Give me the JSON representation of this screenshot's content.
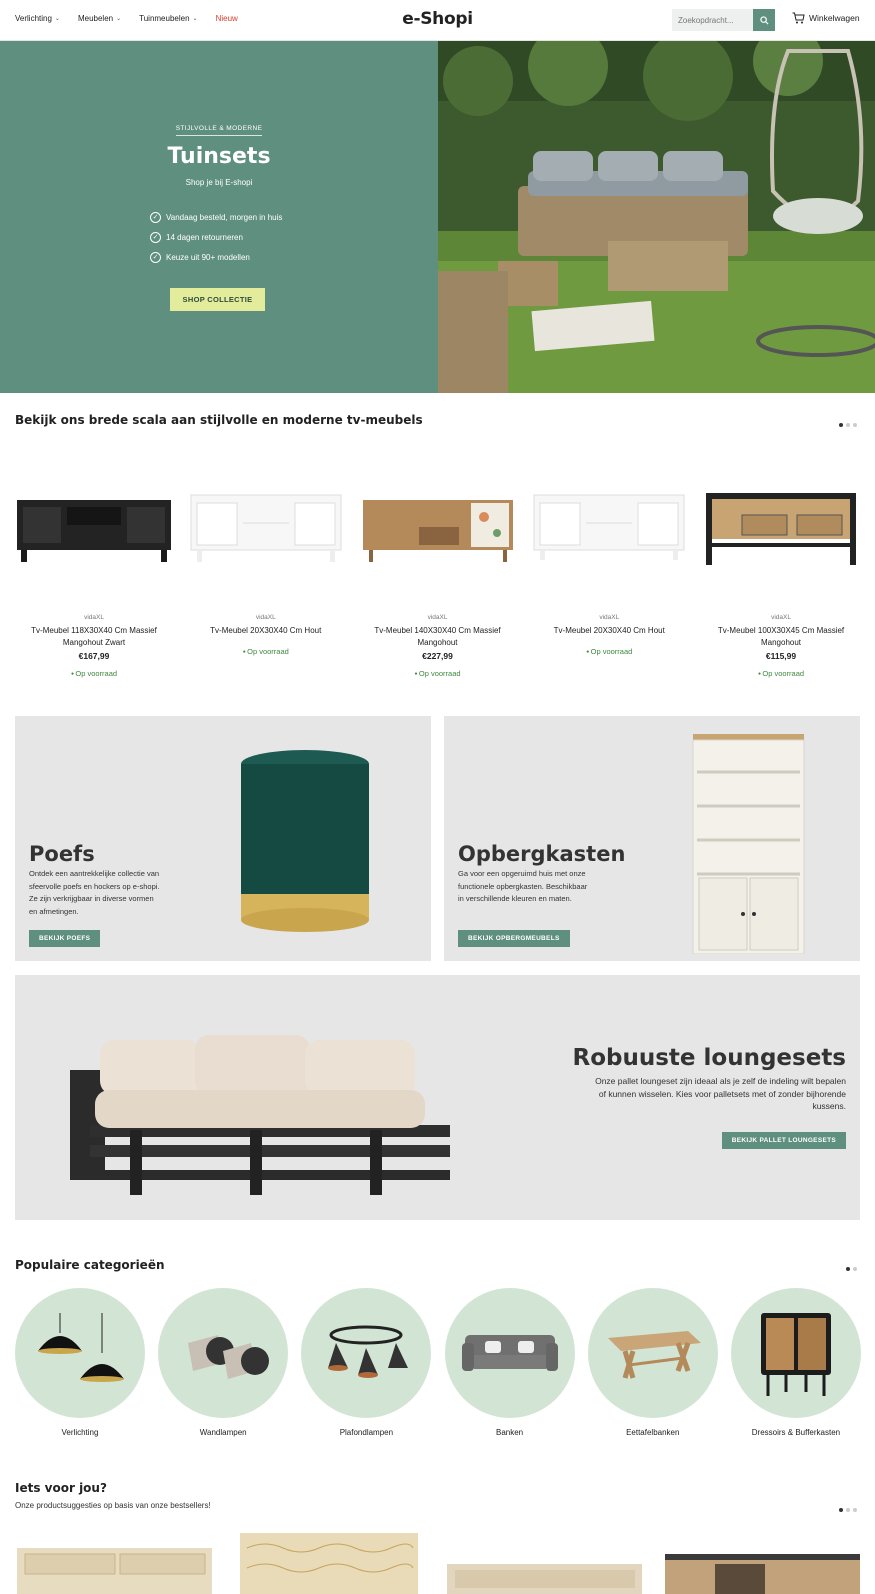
{
  "header": {
    "nav": [
      {
        "label": "Verlichting",
        "has_dropdown": true
      },
      {
        "label": "Meubelen",
        "has_dropdown": true
      },
      {
        "label": "Tuinmeubelen",
        "has_dropdown": true
      },
      {
        "label": "Nieuw",
        "has_dropdown": false,
        "color": "#d9402b"
      }
    ],
    "logo": "e-Shopi",
    "search_placeholder": "Zoekopdracht...",
    "cart_label": "Winkelwagen"
  },
  "hero": {
    "eyebrow": "STIJLVOLLE & MODERNE",
    "title": "Tuinsets",
    "subtitle": "Shop je bij E-shopi",
    "usps": [
      "Vandaag besteld, morgen in huis",
      "14 dagen retourneren",
      "Keuze uit 90+ modellen"
    ],
    "button": "SHOP COLLECTIE",
    "bg_color": "#5f8f7f",
    "button_color": "#e2ec9a"
  },
  "tv_section": {
    "title": "Bekijk ons brede scala aan stijlvolle en moderne tv-meubels",
    "products": [
      {
        "brand": "vidaXL",
        "name": "Tv-Meubel 118X30X40 Cm Massief Mangohout Zwart",
        "price": "€167,99",
        "stock": "Op voorraad"
      },
      {
        "brand": "vidaXL",
        "name": "Tv-Meubel 20X30X40 Cm Hout",
        "price": "",
        "stock": "Op voorraad"
      },
      {
        "brand": "vidaXL",
        "name": "Tv-Meubel 140X30X40 Cm Massief Mangohout",
        "price": "€227,99",
        "stock": "Op voorraad"
      },
      {
        "brand": "vidaXL",
        "name": "Tv-Meubel 20X30X40 Cm Hout",
        "price": "",
        "stock": "Op voorraad"
      },
      {
        "brand": "vidaXL",
        "name": "Tv-Meubel 100X30X45 Cm Massief Mangohout",
        "price": "€115,99",
        "stock": "Op voorraad"
      }
    ]
  },
  "promos": {
    "poefs": {
      "title": "Poefs",
      "desc": "Ontdek een aantrekkelijke collectie van sfeervolle poefs en hockers op e-shopi. Ze zijn verkrijgbaar in diverse vormen en afmetingen.",
      "button": "BEKIJK POEFS"
    },
    "opbergkasten": {
      "title": "Opbergkasten",
      "desc": "Ga voor een opgeruimd huis met onze functionele opbergkasten. Beschikbaar in verschillende kleuren en maten.",
      "button": "BEKIJK OPBERGMEUBELS"
    },
    "loungesets": {
      "title": "Robuuste loungesets",
      "desc": "Onze pallet loungeset zijn ideaal als je zelf de indeling wilt bepalen of kunnen wisselen. Kies voor palletsets met of zonder bijhorende kussens.",
      "button": "BEKIJK PALLET LOUNGESETS"
    }
  },
  "categories": {
    "title": "Populaire categorieën",
    "items": [
      "Verlichting",
      "Wandlampen",
      "Plafondlampen",
      "Banken",
      "Eettafelbanken",
      "Dressoirs & Bufferkasten"
    ],
    "circle_color": "#d2e5d4"
  },
  "suggestions": {
    "title": "Iets voor jou?",
    "subtitle": "Onze productsuggesties op basis van onze bestsellers!"
  }
}
